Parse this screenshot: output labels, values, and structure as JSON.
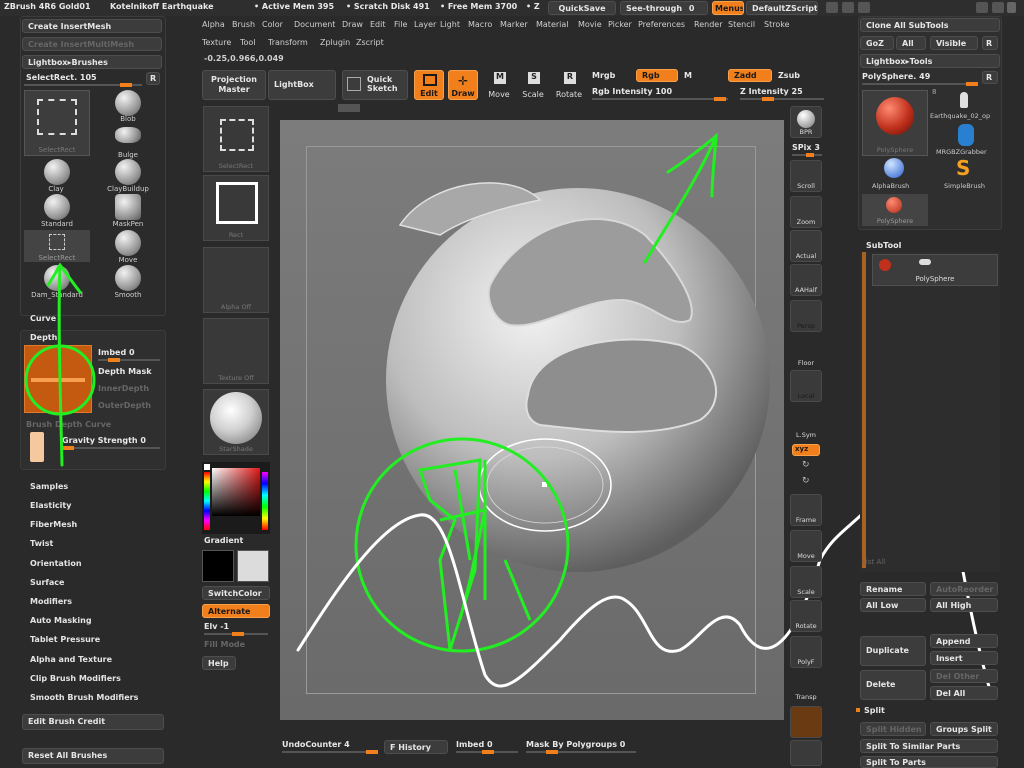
{
  "status_bar": {
    "app": "ZBrush 4R6 Gold01",
    "user": "Kotelnikoff Earthquake",
    "active_mem": "• Active Mem 395",
    "scratch": "• Scratch Disk 491",
    "free_mem": "• Free Mem 3700",
    "extra": "• Z",
    "quicksave": "QuickSave",
    "see_through": "See-through",
    "see_through_val": "0",
    "menus": "Menus",
    "script": "DefaultZScript"
  },
  "menu_bar_1": [
    "Alpha",
    "Brush",
    "Color",
    "Document",
    "Draw",
    "Edit",
    "File",
    "Layer",
    "Light",
    "Macro",
    "Marker",
    "Material",
    "Movie",
    "Picker",
    "Preferences",
    "Render",
    "Stencil",
    "Stroke"
  ],
  "menu_bar_2": [
    "Texture",
    "Tool",
    "Transform",
    "Zplugin",
    "Zscript"
  ],
  "coords": "-0.25,0.966,0.049",
  "top_toolbar": {
    "projection_master": "Projection Master",
    "lightbox": "LightBox",
    "quick_sketch": "Quick Sketch",
    "edit": "Edit",
    "draw": "Draw",
    "move": "Move",
    "scale": "Scale",
    "rotate": "Rotate",
    "mrgb": "Mrgb",
    "rgb": "Rgb",
    "m": "M",
    "rgb_intensity": "Rgb Intensity 100",
    "zadd": "Zadd",
    "zsub": "Zsub",
    "z_intensity": "Z Intensity 25"
  },
  "left_panel": {
    "create_insertmesh": "Create InsertMesh",
    "create_insertmultimesh": "Create InsertMultiMesh",
    "lightbox_brushes": "Lightbox▸Brushes",
    "select_rect": "SelectRect. 105",
    "r": "R",
    "brushes": [
      {
        "label": "SelectRect"
      },
      {
        "label": "Blob"
      },
      {
        "label": "Bulge"
      },
      {
        "label": "Clay"
      },
      {
        "label": "ClayBuildup"
      },
      {
        "label": "Standard"
      },
      {
        "label": "MaskPen"
      },
      {
        "label": "SelectRect"
      },
      {
        "label": "Move"
      },
      {
        "label": "Dam_Standard"
      },
      {
        "label": "Smooth"
      }
    ],
    "curve": "Curve",
    "depth": "Depth",
    "imbed": "Imbed 0",
    "depth_mask": "Depth Mask",
    "inner_depth": "InnerDepth",
    "outer_depth": "OuterDepth",
    "brush_depth_curve": "Brush Depth Curve",
    "gravity_strength": "Gravity Strength 0",
    "menu_items": [
      "Samples",
      "Elasticity",
      "FiberMesh",
      "Twist",
      "Orientation",
      "Surface",
      "Modifiers",
      "Auto Masking",
      "Tablet Pressure",
      "Alpha and Texture",
      "Clip Brush Modifiers",
      "Smooth Brush Modifiers"
    ],
    "edit_brush_credit": "Edit Brush Credit",
    "reset_all_brushes": "Reset All Brushes"
  },
  "thumb_column": {
    "select_rect": "SelectRect",
    "rect": "Rect",
    "alpha_off": "Alpha Off",
    "texture_off": "Texture Off",
    "starshade": "StarShade",
    "gradient": "Gradient",
    "switch_color": "SwitchColor",
    "alternate": "Alternate",
    "elv": "Elv -1",
    "fill_mode": "Fill Mode",
    "help": "Help"
  },
  "right_toolbar": [
    "BPR",
    "SPix 3",
    "Scroll",
    "Zoom",
    "Actual",
    "AAHalf",
    "Persp",
    "Floor",
    "Local",
    "L.Sym",
    "xyz",
    "Frame",
    "Move",
    "Scale",
    "Rotate",
    "PolyF",
    "Transp"
  ],
  "spix": "SPix 3",
  "right_panel": {
    "clone_all": "Clone All SubTools",
    "goz": "GoZ",
    "all": "All",
    "visible": "Visible",
    "r": "R",
    "lightbox_tools": "Lightbox▸Tools",
    "polysphere": "PolySphere. 49",
    "tools": [
      {
        "label": "PolySphere"
      },
      {
        "label": "Earthquake_02_op"
      },
      {
        "label": "MRGBZGrabber"
      },
      {
        "label": "AlphaBrush"
      },
      {
        "label": "SimpleBrush"
      },
      {
        "label": "PolySphere"
      }
    ],
    "tool_count": "8",
    "subtool": "SubTool",
    "subtool_item": "PolySphere",
    "list_all": "List All",
    "rename": "Rename",
    "auto_reorder": "AutoReorder",
    "all_low": "All Low",
    "all_high": "All High",
    "duplicate": "Duplicate",
    "append": "Append",
    "insert": "Insert",
    "delete": "Delete",
    "del_other": "Del Other",
    "del_all": "Del All",
    "split": "Split",
    "split_hidden": "Split Hidden",
    "groups_split": "Groups Split",
    "split_similar": "Split To Similar Parts",
    "split_parts": "Split To Parts"
  },
  "bottom_bar": {
    "undo_counter": "UndoCounter 4",
    "history": "F History",
    "imbed": "Imbed 0",
    "mask_polygroups": "Mask By Polygroups 0"
  },
  "colors": {
    "accent": "#f07f1c",
    "annotation_green": "#22ee22",
    "annotation_white": "#ffffff"
  }
}
